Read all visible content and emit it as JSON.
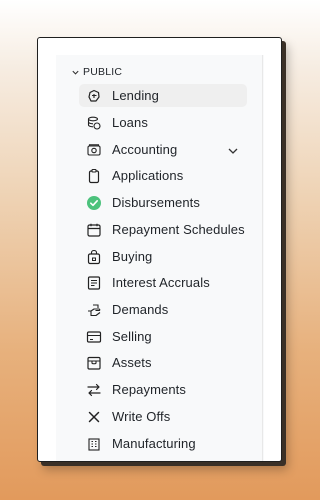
{
  "sidebar": {
    "section_label": "PUBLIC",
    "items": [
      {
        "label": "Lending",
        "icon": "lending-icon"
      },
      {
        "label": "Loans",
        "icon": "loans-icon"
      },
      {
        "label": "Accounting",
        "icon": "accounting-icon"
      },
      {
        "label": "Applications",
        "icon": "clipboard-icon"
      },
      {
        "label": "Disbursements",
        "icon": "check-circle-icon",
        "icon_color": "#4cc27c"
      },
      {
        "label": "Repayment Schedules",
        "icon": "calendar-icon"
      },
      {
        "label": "Buying",
        "icon": "bag-icon"
      },
      {
        "label": "Interest Accruals",
        "icon": "document-icon"
      },
      {
        "label": "Demands",
        "icon": "hand-icon"
      },
      {
        "label": "Selling",
        "icon": "card-icon"
      },
      {
        "label": "Assets",
        "icon": "box-icon"
      },
      {
        "label": "Repayments",
        "icon": "arrows-swap-icon"
      },
      {
        "label": "Write Offs",
        "icon": "x-icon"
      },
      {
        "label": "Manufacturing",
        "icon": "factory-icon"
      }
    ]
  },
  "colors": {
    "active_background": "#efefef",
    "panel_background": "#f8f9fa",
    "text": "#1f2328"
  }
}
